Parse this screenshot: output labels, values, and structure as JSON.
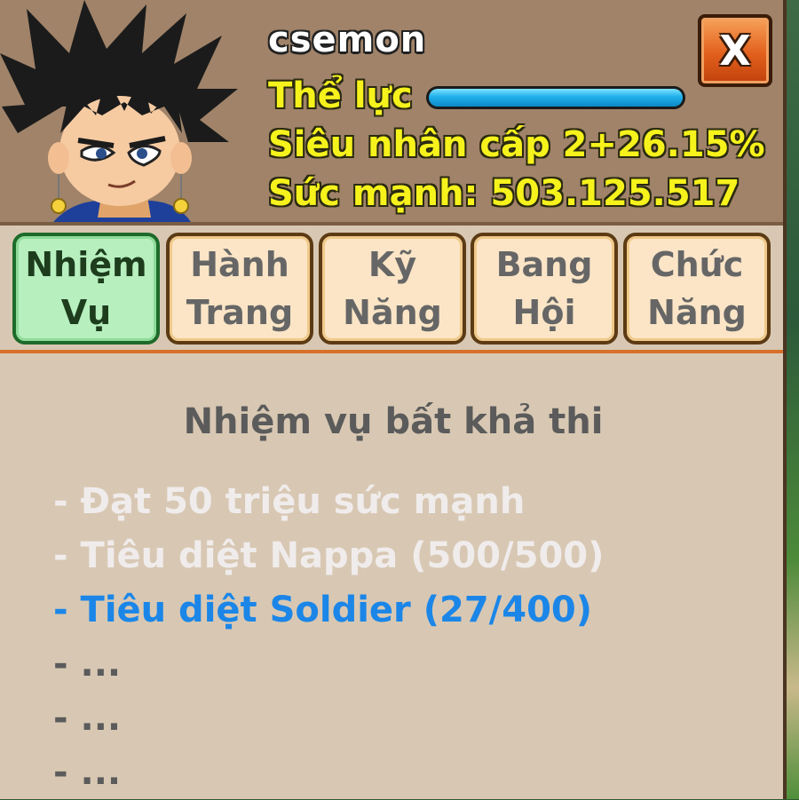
{
  "player": {
    "name": "csemon",
    "stamina_label": "Thể lực",
    "stamina_fraction": 1.0,
    "level_label": "Siêu nhân cấp 2+26.15%",
    "power_label": "Sức mạnh: 503.125.517"
  },
  "close_label": "X",
  "tabs": [
    {
      "line1": "Nhiệm",
      "line2": "Vụ",
      "active": true
    },
    {
      "line1": "Hành",
      "line2": "Trang",
      "active": false
    },
    {
      "line1": "Kỹ",
      "line2": "Năng",
      "active": false
    },
    {
      "line1": "Bang",
      "line2": "Hội",
      "active": false
    },
    {
      "line1": "Chức",
      "line2": "Năng",
      "active": false
    }
  ],
  "quest": {
    "title": "Nhiệm vụ bất khả thi",
    "items": [
      {
        "text": "- Đạt 50 triệu sức mạnh",
        "state": "done"
      },
      {
        "text": "- Tiêu diệt Nappa (500/500)",
        "state": "done"
      },
      {
        "text": "- Tiêu diệt Soldier (27/400)",
        "state": "current"
      },
      {
        "text": "- ...",
        "state": "pending"
      },
      {
        "text": "- ...",
        "state": "pending"
      },
      {
        "text": "- ...",
        "state": "pending"
      }
    ]
  },
  "colors": {
    "panel": "#d8c8b3",
    "header": "#a08369",
    "stat_text": "#f6f21c",
    "current_quest": "#1b86e8",
    "done_quest": "#f0ecec",
    "active_tab": "#b7efbf"
  }
}
